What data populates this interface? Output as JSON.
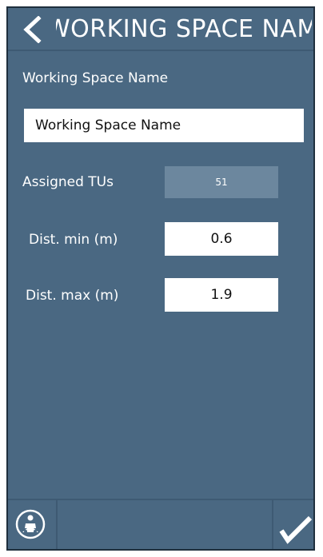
{
  "header": {
    "title": "WORKING SPACE NAME",
    "back_icon": "chevron-left-icon"
  },
  "form": {
    "working_space_label": "Working Space Name",
    "working_space_value": "Working Space Name",
    "assigned_tus_label": "Assigned TUs",
    "assigned_tus_value": "51",
    "dist_min_label": "Dist. min (m)",
    "dist_min_value": "0.6",
    "dist_max_label": "Dist. max (m)",
    "dist_max_value": "1.9"
  },
  "footer": {
    "left_icon": "robot-person-icon",
    "right_icon": "checkmark-icon"
  },
  "colors": {
    "background": "#4a6882",
    "readonly_field": "#6c879e",
    "text": "#ffffff",
    "input_background": "#ffffff"
  }
}
